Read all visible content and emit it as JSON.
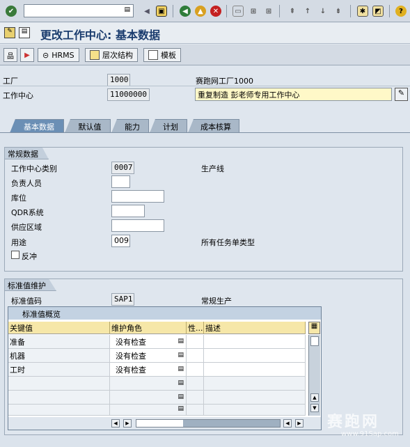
{
  "title": "更改工作中心: 基本数据",
  "app_toolbar": {
    "hrms_label": "HRMS",
    "hierarchy_label": "层次结构",
    "template_label": "模板"
  },
  "header": {
    "plant_label": "工厂",
    "plant_value": "1000",
    "plant_desc": "赛跑网工厂1000",
    "workcenter_label": "工作中心",
    "workcenter_value": "11000000",
    "workcenter_desc": "重复制造 彭老师专用工作中心"
  },
  "tabs": [
    {
      "label": "基本数据",
      "active": true
    },
    {
      "label": "默认值"
    },
    {
      "label": "能力"
    },
    {
      "label": "计划"
    },
    {
      "label": "成本核算"
    }
  ],
  "general": {
    "title": "常规数据",
    "category_label": "工作中心类别",
    "category_value": "0007",
    "category_desc": "生产线",
    "person_label": "负责人员",
    "location_label": "库位",
    "qdr_label": "QDR系统",
    "supply_label": "供应区域",
    "usage_label": "用途",
    "usage_value": "009",
    "usage_desc": "所有任务单类型",
    "backflush_label": "反冲"
  },
  "stdval": {
    "title": "标准值维护",
    "key_label": "标准值码",
    "key_value": "SAP1",
    "key_desc": "常规生产",
    "table_title": "标准值概览",
    "columns": [
      "关键值",
      "维护角色",
      "性...",
      "描述"
    ],
    "rows": [
      {
        "key": "准备",
        "rule": "没有检查"
      },
      {
        "key": "机器",
        "rule": "没有检查"
      },
      {
        "key": "工时",
        "rule": "没有检查"
      }
    ]
  },
  "watermark": "赛跑网",
  "watermark_url": "www.91Sap.com"
}
